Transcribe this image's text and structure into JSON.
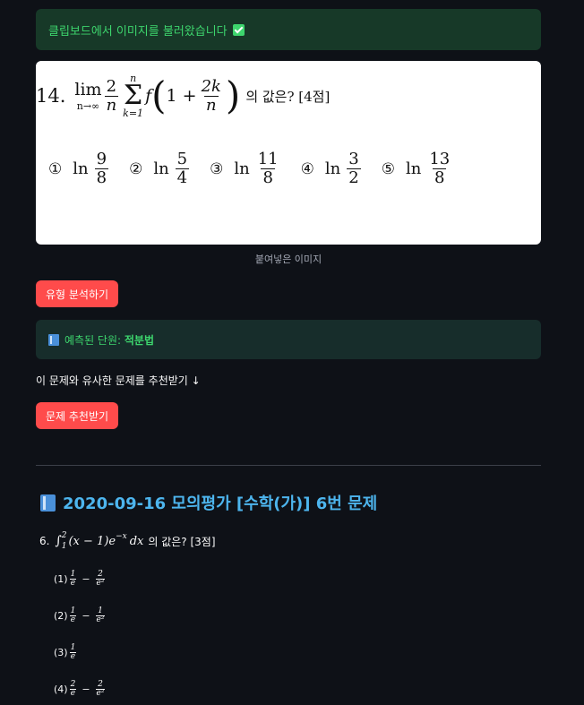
{
  "success_alert": {
    "text": "클립보드에서 이미지를 불러왔습니다"
  },
  "pasted_image": {
    "question_number": "14.",
    "lim_word": "lim",
    "lim_sub": "n→∞",
    "coef_num": "2",
    "coef_den": "n",
    "sum_upper": "n",
    "sum_symbol": "Σ",
    "sum_lower": "k=1",
    "func": "f",
    "inner_one": "1 +",
    "inner_frac_num": "2k",
    "inner_frac_den": "n",
    "suffix": "의 값은? [4점]",
    "choices": [
      {
        "mark": "①",
        "ln": "ln",
        "num": "9",
        "den": "8"
      },
      {
        "mark": "②",
        "ln": "ln",
        "num": "5",
        "den": "4"
      },
      {
        "mark": "③",
        "ln": "ln",
        "num": "11",
        "den": "8"
      },
      {
        "mark": "④",
        "ln": "ln",
        "num": "3",
        "den": "2"
      },
      {
        "mark": "⑤",
        "ln": "ln",
        "num": "13",
        "den": "8"
      }
    ]
  },
  "caption": "붙여넣은 이미지",
  "analyze_button": "유형 분석하기",
  "predicted_unit": {
    "label": "예측된 단원:",
    "value": "적분법"
  },
  "recommend_text": "이 문제와 유사한 문제를 추천받기 ↓",
  "recommend_button": "문제 추천받기",
  "result_heading": "2020-09-16 모의평가 [수학(가)] 6번 문제",
  "problem": {
    "number": "6.",
    "integral": "∫",
    "upper": "2",
    "lower": "1",
    "integrand": "(x − 1)e",
    "exp": "−x",
    "dx": "dx",
    "suffix": "의 값은? [3점]"
  },
  "options": [
    {
      "label": "(1)",
      "a_num": "1",
      "a_den": "e",
      "op": "−",
      "b_num": "2",
      "b_den": "e²"
    },
    {
      "label": "(2)",
      "a_num": "1",
      "a_den": "e",
      "op": "−",
      "b_num": "1",
      "b_den": "e²"
    },
    {
      "label": "(3)",
      "a_num": "1",
      "a_den": "e",
      "op": "",
      "b_num": "",
      "b_den": ""
    },
    {
      "label": "(4)",
      "a_num": "2",
      "a_den": "e",
      "op": "−",
      "b_num": "2",
      "b_den": "e²"
    }
  ]
}
